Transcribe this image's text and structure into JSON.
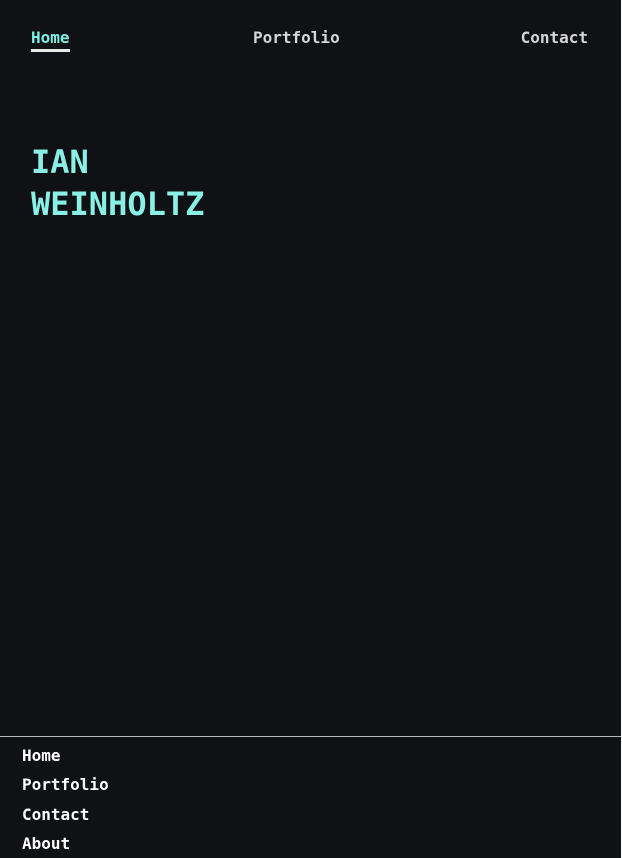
{
  "header": {
    "nav": {
      "home": "Home",
      "portfolio": "Portfolio",
      "contact": "Contact"
    },
    "active_item": "Home"
  },
  "hero": {
    "name_line1": "IAN",
    "name_line2": "WEINHOLTZ"
  },
  "footer": {
    "links": [
      "Home",
      "Portfolio",
      "Contact",
      "About"
    ]
  },
  "colors": {
    "background": "#101114",
    "accent": "#8af0e6",
    "nav_text": "#d6d6d6",
    "footer_text": "#ffffff",
    "divider": "#b8b8b8"
  }
}
